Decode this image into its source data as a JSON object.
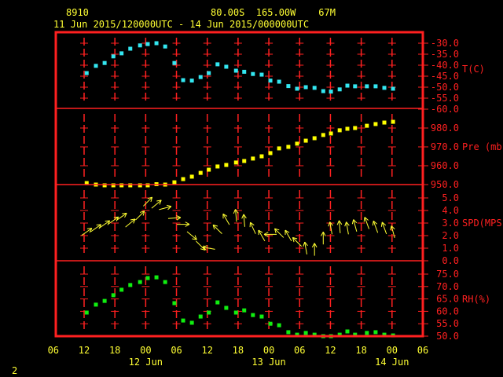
{
  "header": {
    "station": "8910",
    "location": "80.00S  165.00W    67M",
    "period": "11 Jun 2015/120000UTC - 14 Jun 2015/000000UTC"
  },
  "footer": {
    "page_number": "2"
  },
  "colors": {
    "frame": "#ff2020",
    "text": "#ffff33",
    "temperature": "#33e6f0",
    "pressure": "#ffff00",
    "wind": "#ffff33",
    "rh": "#10ee10"
  },
  "chart_data": {
    "type": "scatter",
    "time_unit": "hours since 11 Jun 2015 12UTC",
    "x_ticks": {
      "hours": [
        -6,
        0,
        6,
        12,
        18,
        24,
        30,
        36,
        42,
        48,
        54,
        60,
        66
      ],
      "labels": [
        "06",
        "12",
        "18",
        "00",
        "06",
        "12",
        "18",
        "00",
        "06",
        "12",
        "18",
        "00",
        "06"
      ]
    },
    "date_labels": [
      {
        "hour": 12,
        "label": "12 Jun"
      },
      {
        "hour": 36,
        "label": "13 Jun"
      },
      {
        "hour": 60,
        "label": "14 Jun"
      }
    ],
    "time": [
      0.5,
      2.3,
      4,
      5.7,
      7.3,
      9,
      10.9,
      12.4,
      14.1,
      15.8,
      17.6,
      19.3,
      21,
      22.7,
      24.3,
      26,
      27.7,
      29.6,
      31.2,
      32.9,
      34.6,
      36.3,
      38,
      39.8,
      41.5,
      43.2,
      44.9,
      46.6,
      48.1,
      49.8,
      51.3,
      52.8,
      55.1,
      56.8,
      58.5,
      60.2
    ],
    "panels": [
      {
        "name": "temperature",
        "label": "T(C)",
        "ylim": [
          -60,
          -30
        ],
        "tick_values": [
          -30,
          -35,
          -40,
          -45,
          -50,
          -55,
          -60
        ],
        "tick_labels": [
          "-30.0",
          "-35.0",
          "-40.0",
          "-45.0",
          "-50.0",
          "-55.0",
          "-60.0"
        ],
        "values": [
          -43.6,
          -40.3,
          -39,
          -36,
          -34.6,
          -32.5,
          -31,
          -30.4,
          -30,
          -31.5,
          -39,
          -46.8,
          -47,
          -45.4,
          -43.6,
          -39.6,
          -40.7,
          -42.5,
          -43,
          -44,
          -44.3,
          -47,
          -47.5,
          -49.5,
          -50.7,
          -50,
          -50.3,
          -51.8,
          -52,
          -51,
          -49.3,
          -49.6,
          -49.6,
          -49.6,
          -50.3,
          -50.7
        ]
      },
      {
        "name": "pressure",
        "label": "Pre (mb)",
        "ylim": [
          950,
          990
        ],
        "tick_values": [
          980,
          970,
          960,
          950
        ],
        "tick_labels": [
          "980.0",
          "970.0",
          "960.0",
          "950.0"
        ],
        "values": [
          950.8,
          950,
          949.6,
          949.6,
          949.6,
          949.6,
          949.6,
          949.6,
          950.2,
          950,
          951.2,
          952.9,
          954.2,
          956.2,
          957.9,
          959.6,
          960.4,
          961.7,
          962.5,
          963.8,
          965,
          966.7,
          969.2,
          970,
          971.7,
          973.3,
          974.6,
          976.3,
          977.1,
          978.8,
          979.6,
          980,
          981.2,
          982.1,
          982.9,
          983.3
        ]
      },
      {
        "name": "wind_speed",
        "label": "SPD(MPS)",
        "ylim": [
          0,
          6
        ],
        "tick_values": [
          5,
          4,
          3,
          2,
          1,
          0
        ],
        "tick_labels": [
          "5.0",
          "4.0",
          "3.0",
          "2.0",
          "1.0",
          "0.0"
        ],
        "values": [
          2.3,
          2.6,
          2.9,
          3.2,
          3.5,
          3.0,
          3.6,
          4.7,
          4.5,
          4.2,
          3.4,
          2.9,
          2.0,
          1.2,
          1.0,
          2.5,
          3.3,
          3.6,
          3.2,
          2.6,
          2.0,
          2.1,
          2.2,
          2.0,
          1.5,
          1.0,
          0.9,
          1.8,
          2.6,
          2.7,
          2.6,
          2.8,
          3.0,
          2.7,
          2.6,
          2.3
        ],
        "arrow_angle_deg": [
          35,
          35,
          35,
          35,
          35,
          40,
          45,
          45,
          40,
          15,
          5,
          0,
          -40,
          -45,
          170,
          135,
          120,
          95,
          95,
          115,
          120,
          180,
          135,
          120,
          135,
          100,
          90,
          90,
          100,
          95,
          100,
          105,
          110,
          110,
          110,
          105
        ]
      },
      {
        "name": "relative_humidity",
        "label": "RH(%)",
        "ylim": [
          50,
          80
        ],
        "tick_values": [
          75,
          70,
          65,
          60,
          55,
          50
        ],
        "tick_labels": [
          "75.0",
          "70.0",
          "65.0",
          "60.0",
          "55.0",
          "50.0"
        ],
        "values": [
          59.5,
          62.7,
          64.2,
          66.5,
          68.7,
          70.6,
          71.8,
          73.4,
          73.7,
          71.8,
          63.3,
          56.3,
          55.4,
          57.9,
          59.5,
          63.6,
          61.4,
          59.5,
          60.4,
          58.5,
          57.9,
          55,
          54.4,
          51.6,
          50.6,
          51.3,
          50.6,
          50,
          50,
          50.6,
          51.9,
          50.6,
          51.3,
          51.6,
          50.6,
          50.3
        ]
      }
    ]
  }
}
